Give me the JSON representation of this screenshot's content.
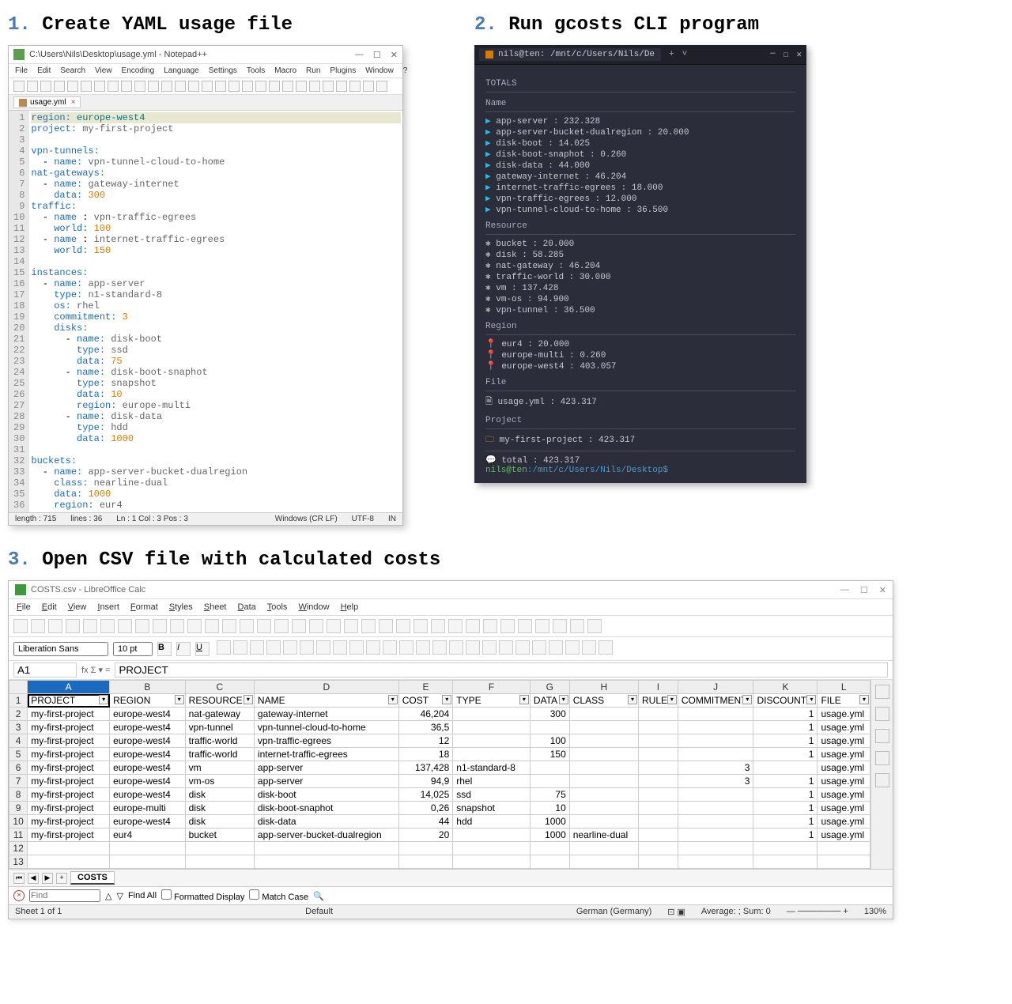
{
  "step1": {
    "num": "1.",
    "title": "Create YAML usage file"
  },
  "step2": {
    "num": "2.",
    "title": "Run gcosts CLI program"
  },
  "step3": {
    "num": "3.",
    "title": "Open CSV file with calculated costs"
  },
  "notepadpp": {
    "title": "C:\\Users\\Nils\\Desktop\\usage.yml - Notepad++",
    "menu": [
      "File",
      "Edit",
      "Search",
      "View",
      "Encoding",
      "Language",
      "Settings",
      "Tools",
      "Macro",
      "Run",
      "Plugins",
      "Window",
      "?"
    ],
    "tab": "usage.yml",
    "lines": [
      {
        "n": 1,
        "html": "<span class='ky'>region:</span> <span class='teal'>europe-west4</span>",
        "hl": true
      },
      {
        "n": 2,
        "html": "<span class='ky'>project:</span> <span class='v'>my-first-project</span>"
      },
      {
        "n": 3,
        "html": ""
      },
      {
        "n": 4,
        "html": "<span class='ky'>vpn-tunnels:</span>"
      },
      {
        "n": 5,
        "html": "  - <span class='ky'>name:</span> <span class='v'>vpn-tunnel-cloud-to-home</span>"
      },
      {
        "n": 6,
        "html": "<span class='ky'>nat-gateways:</span>"
      },
      {
        "n": 7,
        "html": "  - <span class='ky'>name:</span> <span class='v'>gateway-internet</span>"
      },
      {
        "n": 8,
        "html": "    <span class='ky'>data:</span> <span class='num'>300</span>"
      },
      {
        "n": 9,
        "html": "<span class='ky'>traffic:</span>"
      },
      {
        "n": 10,
        "html": "  - <span class='ky'>name</span> : <span class='v'>vpn-traffic-egrees</span>"
      },
      {
        "n": 11,
        "html": "    <span class='ky'>world:</span> <span class='num'>100</span>"
      },
      {
        "n": 12,
        "html": "  - <span class='ky'>name</span> : <span class='v'>internet-traffic-egrees</span>"
      },
      {
        "n": 13,
        "html": "    <span class='ky'>world:</span> <span class='num'>150</span>"
      },
      {
        "n": 14,
        "html": ""
      },
      {
        "n": 15,
        "html": "<span class='ky'>instances:</span>"
      },
      {
        "n": 16,
        "html": "  - <span class='ky'>name:</span> <span class='v'>app-server</span>"
      },
      {
        "n": 17,
        "html": "    <span class='ky'>type:</span> <span class='v'>n1-standard-8</span>"
      },
      {
        "n": 18,
        "html": "    <span class='ky'>os:</span> <span class='v'>rhel</span>"
      },
      {
        "n": 19,
        "html": "    <span class='ky'>commitment:</span> <span class='num'>3</span>"
      },
      {
        "n": 20,
        "html": "    <span class='ky'>disks:</span>"
      },
      {
        "n": 21,
        "html": "      - <span class='ky'>name:</span> <span class='v'>disk-boot</span>"
      },
      {
        "n": 22,
        "html": "        <span class='ky'>type:</span> <span class='v'>ssd</span>"
      },
      {
        "n": 23,
        "html": "        <span class='ky'>data:</span> <span class='num'>75</span>"
      },
      {
        "n": 24,
        "html": "      - <span class='ky'>name:</span> <span class='v'>disk-boot-snaphot</span>"
      },
      {
        "n": 25,
        "html": "        <span class='ky'>type:</span> <span class='v'>snapshot</span>"
      },
      {
        "n": 26,
        "html": "        <span class='ky'>data:</span> <span class='num'>10</span>"
      },
      {
        "n": 27,
        "html": "        <span class='ky'>region:</span> <span class='v'>europe-multi</span>"
      },
      {
        "n": 28,
        "html": "      - <span class='ky'>name:</span> <span class='v'>disk-data</span>"
      },
      {
        "n": 29,
        "html": "        <span class='ky'>type:</span> <span class='v'>hdd</span>"
      },
      {
        "n": 30,
        "html": "        <span class='ky'>data:</span> <span class='num'>1000</span>"
      },
      {
        "n": 31,
        "html": ""
      },
      {
        "n": 32,
        "html": "<span class='ky'>buckets:</span>"
      },
      {
        "n": 33,
        "html": "  - <span class='ky'>name:</span> <span class='v'>app-server-bucket-dualregion</span>"
      },
      {
        "n": 34,
        "html": "    <span class='ky'>class:</span> <span class='v'>nearline-dual</span>"
      },
      {
        "n": 35,
        "html": "    <span class='ky'>data:</span> <span class='num'>1000</span>"
      },
      {
        "n": 36,
        "html": "    <span class='ky'>region:</span> <span class='v'>eur4</span>"
      }
    ],
    "status": {
      "len": "length : 715",
      "lines": "lines : 36",
      "pos": "Ln : 1   Col : 3   Pos : 3",
      "eol": "Windows (CR LF)",
      "enc": "UTF-8",
      "mode": "IN"
    }
  },
  "terminal": {
    "tab": "nils@ten: /mnt/c/Users/Nils/De",
    "header": "TOTALS",
    "sections": [
      {
        "title": "Name",
        "cls": "cyan",
        "items": [
          "app-server : 232.328",
          "app-server-bucket-dualregion : 20.000",
          "disk-boot : 14.025",
          "disk-boot-snaphot : 0.260",
          "disk-data : 44.000",
          "gateway-internet : 46.204",
          "internet-traffic-egrees : 18.000",
          "vpn-traffic-egrees : 12.000",
          "vpn-tunnel-cloud-to-home : 36.500"
        ]
      },
      {
        "title": "Resource",
        "cls": "gear",
        "items": [
          "bucket : 20.000",
          "disk : 58.285",
          "nat-gateway : 46.204",
          "traffic-world : 30.000",
          "vm : 137.428",
          "vm-os : 94.900",
          "vpn-tunnel : 36.500"
        ]
      },
      {
        "title": "Region",
        "cls": "pin",
        "items": [
          "eur4 : 20.000",
          "europe-multi : 0.260",
          "europe-west4 : 403.057"
        ]
      },
      {
        "title": "File",
        "cls": "file",
        "items": [
          "usage.yml : 423.317"
        ]
      },
      {
        "title": "Project",
        "cls": "folder",
        "items": [
          "my-first-project : 423.317"
        ]
      }
    ],
    "total": "total : 423.317",
    "prompt": {
      "user": "nils@ten",
      "path": ":/mnt/c/Users/Nils/Desktop$"
    }
  },
  "libre": {
    "title": "COSTS.csv - LibreOffice Calc",
    "menu": [
      "File",
      "Edit",
      "View",
      "Insert",
      "Format",
      "Styles",
      "Sheet",
      "Data",
      "Tools",
      "Window",
      "Help"
    ],
    "font": "Liberation Sans",
    "size": "10 pt",
    "cell": "A1",
    "formula": "PROJECT",
    "cols": [
      "A",
      "B",
      "C",
      "D",
      "E",
      "F",
      "G",
      "H",
      "I",
      "J",
      "K",
      "L"
    ],
    "widths": [
      100,
      92,
      84,
      176,
      66,
      94,
      48,
      84,
      48,
      92,
      78,
      64
    ],
    "header": [
      "PROJECT",
      "REGION",
      "RESOURCE",
      "NAME",
      "COST",
      "TYPE",
      "DATA",
      "CLASS",
      "RULE",
      "COMMITMENT",
      "DISCOUNT",
      "FILE"
    ],
    "rows": [
      [
        "my-first-project",
        "europe-west4",
        "nat-gateway",
        "gateway-internet",
        "46,204",
        "",
        "300",
        "",
        "",
        "",
        "1",
        "usage.yml"
      ],
      [
        "my-first-project",
        "europe-west4",
        "vpn-tunnel",
        "vpn-tunnel-cloud-to-home",
        "36,5",
        "",
        "",
        "",
        "",
        "",
        "1",
        "usage.yml"
      ],
      [
        "my-first-project",
        "europe-west4",
        "traffic-world",
        "vpn-traffic-egrees",
        "12",
        "",
        "100",
        "",
        "",
        "",
        "1",
        "usage.yml"
      ],
      [
        "my-first-project",
        "europe-west4",
        "traffic-world",
        "internet-traffic-egrees",
        "18",
        "",
        "150",
        "",
        "",
        "",
        "1",
        "usage.yml"
      ],
      [
        "my-first-project",
        "europe-west4",
        "vm",
        "app-server",
        "137,428",
        "n1-standard-8",
        "",
        "",
        "",
        "3",
        "",
        "usage.yml"
      ],
      [
        "my-first-project",
        "europe-west4",
        "vm-os",
        "app-server",
        "94,9",
        "rhel",
        "",
        "",
        "",
        "3",
        "1",
        "usage.yml"
      ],
      [
        "my-first-project",
        "europe-west4",
        "disk",
        "disk-boot",
        "14,025",
        "ssd",
        "75",
        "",
        "",
        "",
        "1",
        "usage.yml"
      ],
      [
        "my-first-project",
        "europe-multi",
        "disk",
        "disk-boot-snaphot",
        "0,26",
        "snapshot",
        "10",
        "",
        "",
        "",
        "1",
        "usage.yml"
      ],
      [
        "my-first-project",
        "europe-west4",
        "disk",
        "disk-data",
        "44",
        "hdd",
        "1000",
        "",
        "",
        "",
        "1",
        "usage.yml"
      ],
      [
        "my-first-project",
        "eur4",
        "bucket",
        "app-server-bucket-dualregion",
        "20",
        "",
        "1000",
        "nearline-dual",
        "",
        "",
        "1",
        "usage.yml"
      ]
    ],
    "sheetname": "COSTS",
    "find": {
      "label": "Find",
      "findall": "Find All",
      "fmt": "Formatted Display",
      "match": "Match Case"
    },
    "status": {
      "sheet": "Sheet 1 of 1",
      "style": "Default",
      "lang": "German (Germany)",
      "avg": "Average: ; Sum: 0",
      "zoom": "130%"
    }
  }
}
